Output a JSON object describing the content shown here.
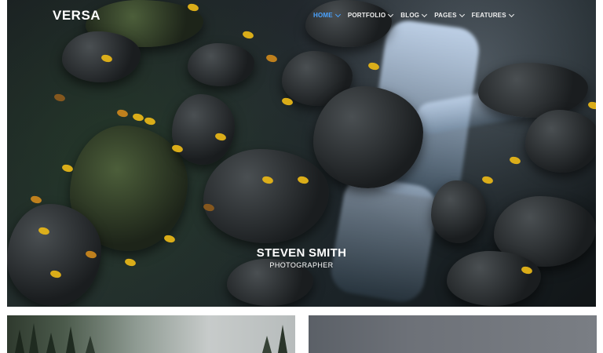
{
  "brand": {
    "logo_text": "VERSA"
  },
  "nav": {
    "items": [
      {
        "label": "HOME",
        "active": true
      },
      {
        "label": "PORTFOLIO",
        "active": false
      },
      {
        "label": "BLOG",
        "active": false
      },
      {
        "label": "PAGES",
        "active": false
      },
      {
        "label": "FEATURES",
        "active": false
      }
    ],
    "active_color": "#4aa3ff"
  },
  "hero": {
    "title": "STEVEN SMITH",
    "subtitle": "PHOTOGRAPHER"
  },
  "grid": {
    "cards": [
      {
        "name": "forest-misty-photo"
      },
      {
        "name": "overcast-sky-photo"
      }
    ]
  }
}
